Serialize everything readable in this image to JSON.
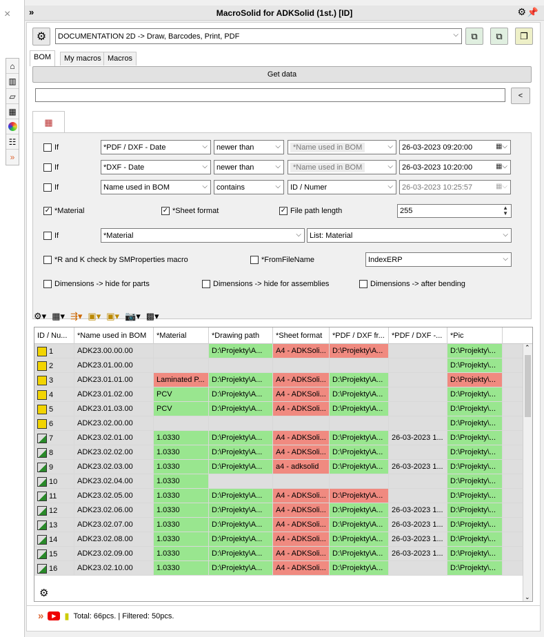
{
  "title": "MacroSolid for ADKSolid (1st.) [ID]",
  "macro_select": "DOCUMENTATION 2D -> Draw, Barcodes, Print, PDF",
  "tabs": [
    "BOM",
    "My macros",
    "Macros"
  ],
  "get_data_label": "Get data",
  "back_label": "<",
  "filters": [
    {
      "if_label": "If",
      "field": "*PDF / DXF - Date",
      "op": "newer than",
      "ref": "*Name used in BOM",
      "value": "26-03-2023 09:20:00"
    },
    {
      "if_label": "If",
      "field": "*DXF - Date",
      "op": "newer than",
      "ref": "*Name used in BOM",
      "value": "26-03-2023 10:20:00"
    },
    {
      "if_label": "If",
      "field": "Name used in BOM",
      "op": "contains",
      "ref": "ID / Numer",
      "value": "26-03-2023 10:25:57"
    }
  ],
  "checks": {
    "material": "*Material",
    "sheet_format": "*Sheet format",
    "file_path_length": "File path length",
    "file_path_value": "255",
    "if4": "If",
    "if4_field": "*Material",
    "if4_list": "List: Material",
    "rk_check": "*R and K check by SMProperties macro",
    "from_file_name": "*FromFileName",
    "index_erp": "IndexERP",
    "dim_parts": "Dimensions -> hide for parts",
    "dim_assemblies": "Dimensions -> hide for assemblies",
    "dim_bending": "Dimensions -> after bending"
  },
  "columns": [
    "ID / Nu...",
    "*Name used in BOM",
    "*Material",
    "*Drawing path",
    "*Sheet format",
    "*PDF / DXF fr...",
    "*PDF / DXF -...",
    "*Pic"
  ],
  "rows": [
    {
      "id": "1",
      "name": "ADK23.00.00.00",
      "mat": "",
      "path": "D:\\Projekty\\A...",
      "sheet": "A4 - ADKSoli...",
      "pdf": "D:\\Projekty\\A...",
      "date": "",
      "pic": "D:\\Projekty\\...",
      "c": [
        "n",
        "n",
        "n",
        "g",
        "r",
        "r",
        "n",
        "g"
      ]
    },
    {
      "id": "2",
      "name": "ADK23.01.00.00",
      "mat": "",
      "path": "",
      "sheet": "",
      "pdf": "",
      "date": "",
      "pic": "D:\\Projekty\\...",
      "c": [
        "n",
        "n",
        "n",
        "n",
        "n",
        "n",
        "n",
        "g"
      ]
    },
    {
      "id": "3",
      "name": "ADK23.01.01.00",
      "mat": "Laminated P...",
      "path": "D:\\Projekty\\A...",
      "sheet": "A4 - ADKSoli...",
      "pdf": "D:\\Projekty\\A...",
      "date": "",
      "pic": "D:\\Projekty\\...",
      "c": [
        "n",
        "n",
        "r",
        "g",
        "r",
        "g",
        "n",
        "r"
      ]
    },
    {
      "id": "4",
      "name": "ADK23.01.02.00",
      "mat": "PCV",
      "path": "D:\\Projekty\\A...",
      "sheet": "A4 - ADKSoli...",
      "pdf": "D:\\Projekty\\A...",
      "date": "",
      "pic": "D:\\Projekty\\...",
      "c": [
        "n",
        "n",
        "g",
        "g",
        "r",
        "g",
        "n",
        "g"
      ]
    },
    {
      "id": "5",
      "name": "ADK23.01.03.00",
      "mat": "PCV",
      "path": "D:\\Projekty\\A...",
      "sheet": "A4 - ADKSoli...",
      "pdf": "D:\\Projekty\\A...",
      "date": "",
      "pic": "D:\\Projekty\\...",
      "c": [
        "n",
        "n",
        "g",
        "g",
        "r",
        "g",
        "n",
        "g"
      ]
    },
    {
      "id": "6",
      "name": "ADK23.02.00.00",
      "mat": "",
      "path": "",
      "sheet": "",
      "pdf": "",
      "date": "",
      "pic": "D:\\Projekty\\...",
      "c": [
        "n",
        "n",
        "n",
        "n",
        "n",
        "n",
        "n",
        "g"
      ]
    },
    {
      "id": "7",
      "name": "ADK23.02.01.00",
      "mat": "1.0330",
      "path": "D:\\Projekty\\A...",
      "sheet": "A4 - ADKSoli...",
      "pdf": "D:\\Projekty\\A...",
      "date": "26-03-2023 1...",
      "pic": "D:\\Projekty\\...",
      "c": [
        "n",
        "n",
        "g",
        "g",
        "r",
        "g",
        "n",
        "g"
      ]
    },
    {
      "id": "8",
      "name": "ADK23.02.02.00",
      "mat": "1.0330",
      "path": "D:\\Projekty\\A...",
      "sheet": "A4 - ADKSoli...",
      "pdf": "D:\\Projekty\\A...",
      "date": "",
      "pic": "D:\\Projekty\\...",
      "c": [
        "n",
        "n",
        "g",
        "g",
        "r",
        "g",
        "n",
        "g"
      ]
    },
    {
      "id": "9",
      "name": "ADK23.02.03.00",
      "mat": "1.0330",
      "path": "D:\\Projekty\\A...",
      "sheet": "a4 - adksolid",
      "pdf": "D:\\Projekty\\A...",
      "date": "26-03-2023 1...",
      "pic": "D:\\Projekty\\...",
      "c": [
        "n",
        "n",
        "g",
        "g",
        "r",
        "g",
        "n",
        "g"
      ]
    },
    {
      "id": "10",
      "name": "ADK23.02.04.00",
      "mat": "1.0330",
      "path": "",
      "sheet": "",
      "pdf": "",
      "date": "",
      "pic": "D:\\Projekty\\...",
      "c": [
        "n",
        "n",
        "g",
        "n",
        "n",
        "n",
        "n",
        "g"
      ]
    },
    {
      "id": "11",
      "name": "ADK23.02.05.00",
      "mat": "1.0330",
      "path": "D:\\Projekty\\A...",
      "sheet": "A4 - ADKSoli...",
      "pdf": "D:\\Projekty\\A...",
      "date": "",
      "pic": "D:\\Projekty\\...",
      "c": [
        "n",
        "n",
        "g",
        "g",
        "r",
        "r",
        "n",
        "g"
      ]
    },
    {
      "id": "12",
      "name": "ADK23.02.06.00",
      "mat": "1.0330",
      "path": "D:\\Projekty\\A...",
      "sheet": "A4 - ADKSoli...",
      "pdf": "D:\\Projekty\\A...",
      "date": "26-03-2023 1...",
      "pic": "D:\\Projekty\\...",
      "c": [
        "n",
        "n",
        "g",
        "g",
        "r",
        "g",
        "n",
        "g"
      ]
    },
    {
      "id": "13",
      "name": "ADK23.02.07.00",
      "mat": "1.0330",
      "path": "D:\\Projekty\\A...",
      "sheet": "A4 - ADKSoli...",
      "pdf": "D:\\Projekty\\A...",
      "date": "26-03-2023 1...",
      "pic": "D:\\Projekty\\...",
      "c": [
        "n",
        "n",
        "g",
        "g",
        "r",
        "g",
        "n",
        "g"
      ]
    },
    {
      "id": "14",
      "name": "ADK23.02.08.00",
      "mat": "1.0330",
      "path": "D:\\Projekty\\A...",
      "sheet": "A4 - ADKSoli...",
      "pdf": "D:\\Projekty\\A...",
      "date": "26-03-2023 1...",
      "pic": "D:\\Projekty\\...",
      "c": [
        "n",
        "n",
        "g",
        "g",
        "r",
        "g",
        "n",
        "g"
      ]
    },
    {
      "id": "15",
      "name": "ADK23.02.09.00",
      "mat": "1.0330",
      "path": "D:\\Projekty\\A...",
      "sheet": "A4 - ADKSoli...",
      "pdf": "D:\\Projekty\\A...",
      "date": "26-03-2023 1...",
      "pic": "D:\\Projekty\\...",
      "c": [
        "n",
        "n",
        "g",
        "g",
        "r",
        "g",
        "n",
        "g"
      ]
    },
    {
      "id": "16",
      "name": "ADK23.02.10.00",
      "mat": "1.0330",
      "path": "D:\\Projekty\\A...",
      "sheet": "A4 - ADKSoli...",
      "pdf": "D:\\Projekty\\A...",
      "date": "",
      "pic": "D:\\Projekty\\...",
      "c": [
        "n",
        "n",
        "g",
        "g",
        "r",
        "g",
        "n",
        "g"
      ]
    }
  ],
  "status_text": "Total: 66pcs. | Filtered: 50pcs.",
  "colors": {
    "green": "#99e68f",
    "red": "#f08a80",
    "neutral": "#dedede"
  }
}
